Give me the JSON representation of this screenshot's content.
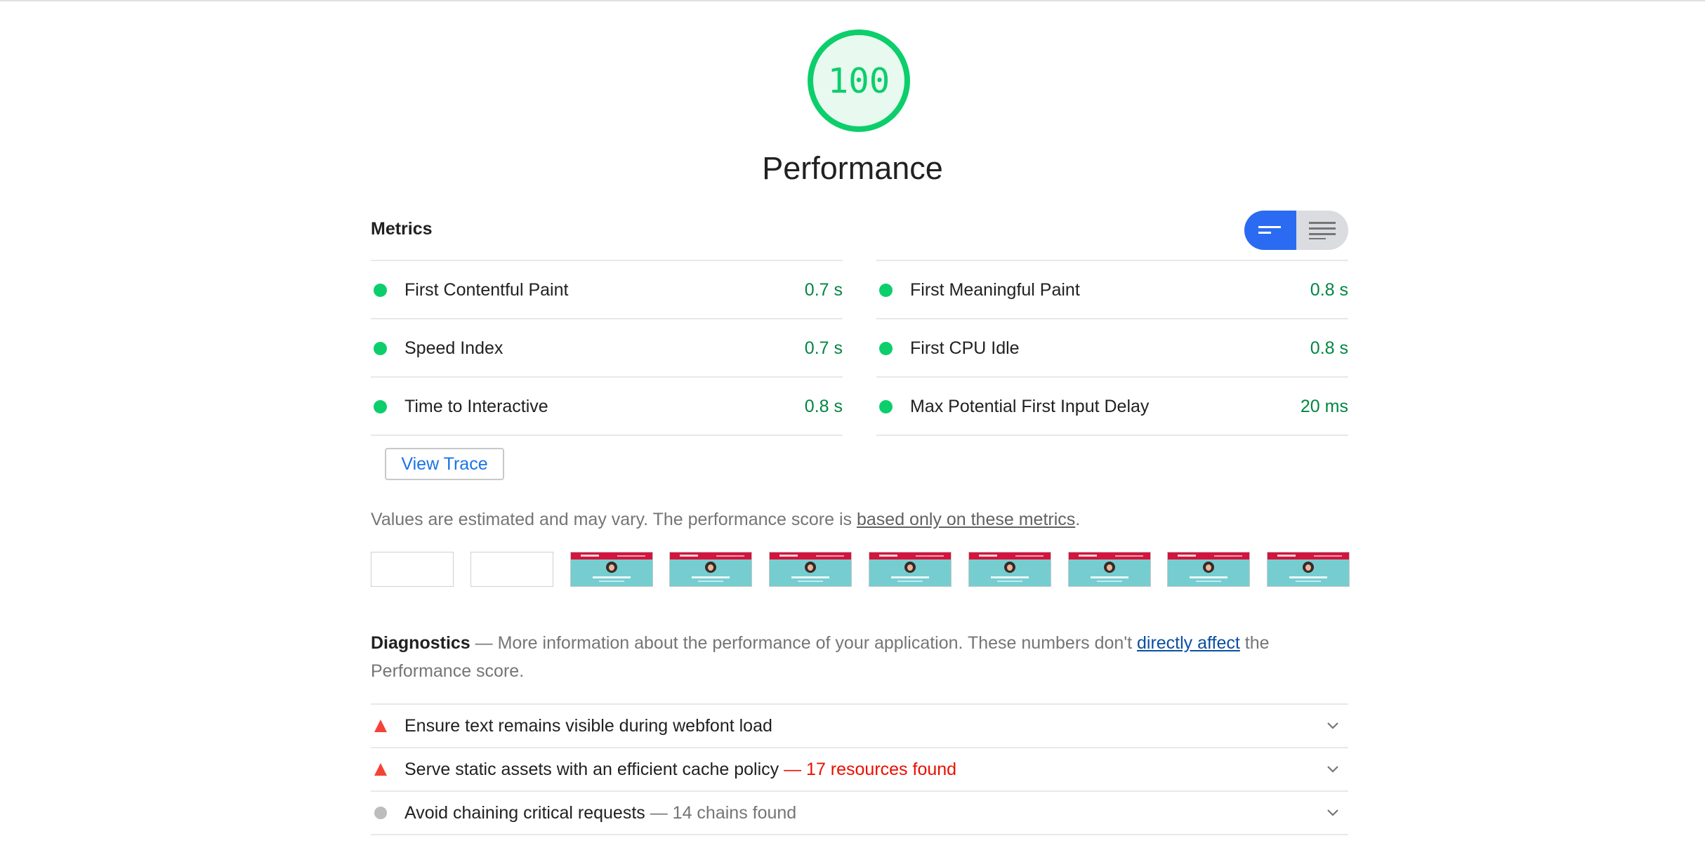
{
  "score": {
    "value": "100",
    "title": "Performance"
  },
  "metrics": {
    "title": "Metrics",
    "left": [
      {
        "label": "First Contentful Paint",
        "value": "0.7 s"
      },
      {
        "label": "Speed Index",
        "value": "0.7 s"
      },
      {
        "label": "Time to Interactive",
        "value": "0.8 s"
      }
    ],
    "right": [
      {
        "label": "First Meaningful Paint",
        "value": "0.8 s"
      },
      {
        "label": "First CPU Idle",
        "value": "0.8 s"
      },
      {
        "label": "Max Potential First Input Delay",
        "value": "20 ms"
      }
    ],
    "view_trace_label": "View Trace",
    "toggle_icons": [
      "view-opportunities-icon",
      "view-list-icon"
    ]
  },
  "estimated": {
    "prefix": "Values are estimated and may vary. The performance score is ",
    "link": "based only on these metrics",
    "suffix": "."
  },
  "filmstrip": {
    "frames_blank": 2,
    "frames_loaded": 8
  },
  "diagnostics": {
    "title": "Diagnostics",
    "dash": "—",
    "text_before": "More information about the performance of your application. These numbers don't ",
    "link": "directly affect",
    "text_after": " the Performance score."
  },
  "audits": [
    {
      "label": "Ensure text remains visible during webfont load",
      "display": "",
      "status": "fail"
    },
    {
      "label": "Serve static assets with an efficient cache policy",
      "display": "— 17 resources found",
      "status": "fail"
    },
    {
      "label": "Avoid chaining critical requests",
      "display": "— 14 chains found",
      "status": "neutral"
    }
  ],
  "colors": {
    "pass": "#0cce6b",
    "pass_text": "#018642",
    "fail": "#eb0f00",
    "neutral": "#757575",
    "accent": "#2a6bf2"
  }
}
